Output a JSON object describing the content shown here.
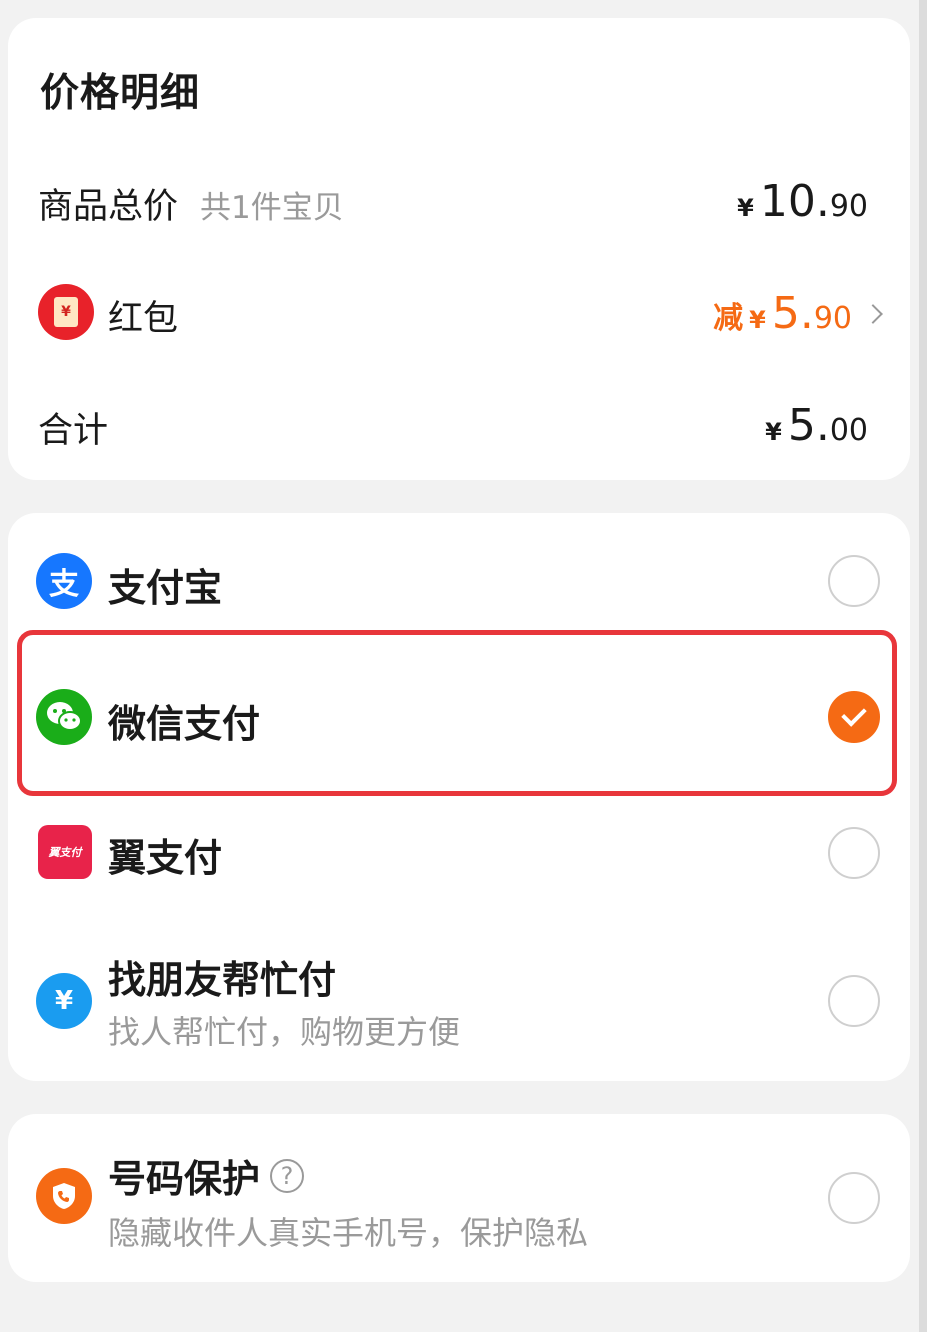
{
  "price_detail": {
    "title": "价格明细",
    "goods_total": {
      "label": "商品总价",
      "sub": "共1件宝贝",
      "yen": "¥",
      "int": "10.",
      "dec": "90"
    },
    "red_packet": {
      "label": "红包",
      "icon_glyph": "¥",
      "prefix": "减",
      "yen": "¥",
      "int": "5.",
      "dec": "90"
    },
    "total": {
      "label": "合计",
      "yen": "¥",
      "int": "5.",
      "dec": "00"
    }
  },
  "payment": {
    "methods": [
      {
        "label": "支付宝",
        "icon": "alipay-icon",
        "icon_glyph": "支",
        "icon_color": "#1677ff",
        "selected": false
      },
      {
        "label": "微信支付",
        "icon": "wechat-pay-icon",
        "icon_color": "#1aad19",
        "selected": true
      },
      {
        "label": "翼支付",
        "icon": "bestpay-icon",
        "icon_glyph": "翼支付",
        "icon_color": "#e8234a",
        "selected": false
      },
      {
        "label": "找朋友帮忙付",
        "sub": "找人帮忙付，购物更方便",
        "icon": "friend-pay-icon",
        "icon_glyph": "¥",
        "icon_color": "#1a9cf0",
        "selected": false
      }
    ]
  },
  "number_protection": {
    "label": "号码保护",
    "help_glyph": "?",
    "sub": "隐藏收件人真实手机号，保护隐私",
    "icon": "phone-shield-icon",
    "icon_color": "#f56a14",
    "selected": false
  },
  "colors": {
    "accent": "#f56a14",
    "highlight_border": "#e8363b",
    "muted_text": "#9a9a9a"
  }
}
